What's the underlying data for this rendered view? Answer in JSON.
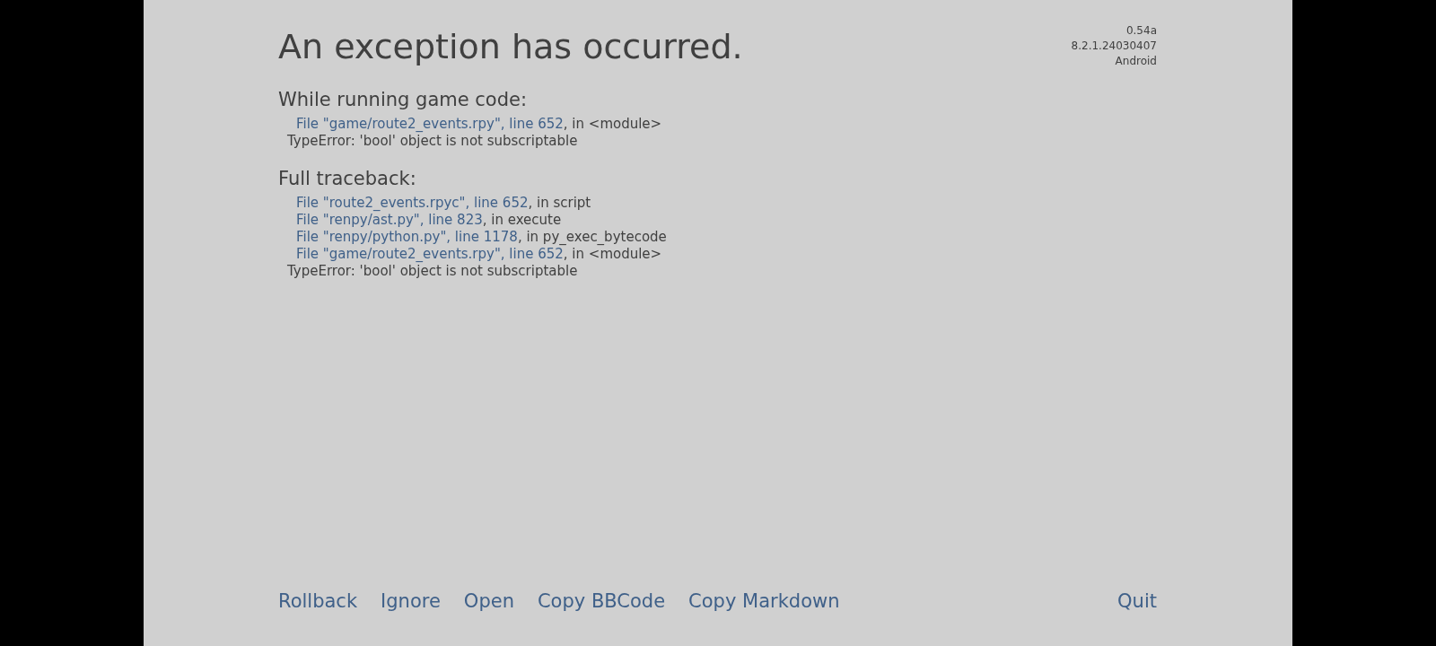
{
  "version_lines": [
    "0.54a",
    "8.2.1.24030407",
    "Android"
  ],
  "title": "An exception has occurred.",
  "sections": [
    {
      "heading": "While running game code:",
      "frames": [
        {
          "link": "File \"game/route2_events.rpy\", line 652",
          "rest": ", in <module>"
        }
      ],
      "error": "TypeError: 'bool' object is not subscriptable"
    },
    {
      "heading": "Full traceback:",
      "frames": [
        {
          "link": "File \"route2_events.rpyc\", line 652",
          "rest": ", in script"
        },
        {
          "link": "File \"renpy/ast.py\", line 823",
          "rest": ", in execute"
        },
        {
          "link": "File \"renpy/python.py\", line 1178",
          "rest": ", in py_exec_bytecode"
        },
        {
          "link": "File \"game/route2_events.rpy\", line 652",
          "rest": ", in <module>"
        }
      ],
      "error": "TypeError: 'bool' object is not subscriptable"
    }
  ],
  "actions": [
    "Rollback",
    "Ignore",
    "Open",
    "Copy BBCode",
    "Copy Markdown"
  ],
  "quit": "Quit"
}
